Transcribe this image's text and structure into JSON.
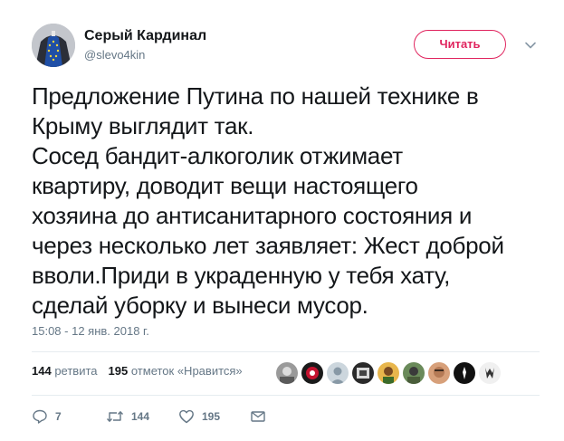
{
  "author": {
    "name": "Серый Кардинал",
    "handle": "@slevo4kin"
  },
  "follow_button": {
    "label": "Читать"
  },
  "tweet": {
    "text": "Предложение Путина по нашей технике в\nКрыму выглядит так.\nСосед бандит-алкоголик отжимает\nквартиру, доводит вещи настоящего\nхозяина до антисанитарного состояния и\nчерез несколько лет заявляет: Жест доброй\nвволи.Приди в украденную у тебя хату,\nсделай уборку и вынеси мусор.",
    "timestamp": "15:08 - 12 янв. 2018 г."
  },
  "stats": {
    "retweets_count": "144",
    "retweets_label": "ретвита",
    "likes_count": "195",
    "likes_label": "отметок «Нравится»"
  },
  "likers": [
    {
      "icon": "avatar-1"
    },
    {
      "icon": "avatar-2"
    },
    {
      "icon": "avatar-3"
    },
    {
      "icon": "avatar-4"
    },
    {
      "icon": "avatar-5"
    },
    {
      "icon": "avatar-6"
    },
    {
      "icon": "avatar-7"
    },
    {
      "icon": "avatar-8"
    },
    {
      "icon": "avatar-9"
    }
  ],
  "actions": {
    "reply_count": "7",
    "retweet_count": "144",
    "like_count": "195"
  },
  "colors": {
    "accent": "#e0245e",
    "secondary_text": "#657786",
    "primary_text": "#14171a",
    "divider": "#e6ecf0"
  }
}
